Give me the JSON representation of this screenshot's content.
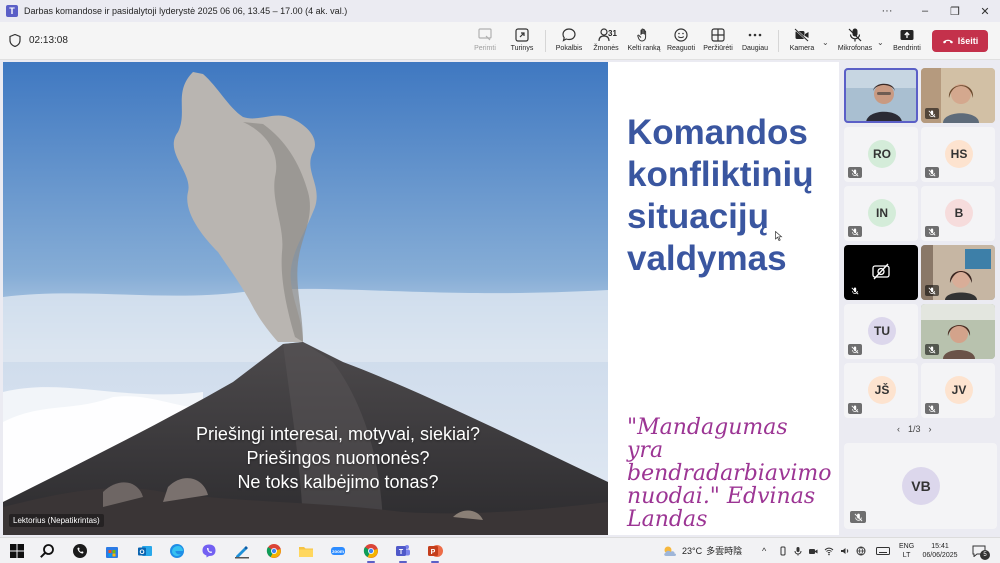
{
  "window": {
    "title": "Darbas komandose ir pasidalytoji lyderystė 2025 06 06, 13.45 – 17.00 (4 ak. val.)",
    "controls": {
      "more": "···",
      "minimize": "–",
      "maximize": "❐",
      "close": "✕"
    }
  },
  "meeting": {
    "timer": "02:13:08",
    "toolbar": {
      "take_control": "Perimti",
      "content": "Turinys",
      "chat": "Pokalbis",
      "people": "Žmonės",
      "people_count": "31",
      "raise_hand": "Kelti ranką",
      "react": "Reaguoti",
      "view": "Peržiūrėti",
      "more": "Daugiau",
      "camera": "Kamera",
      "mic": "Mikrofonas",
      "share": "Bendrinti",
      "leave": "Išeiti"
    }
  },
  "slide": {
    "overlay_lines": [
      "Priešingi interesai, motyvai, siekiai?",
      "Priešingos nuomonės?",
      "Ne toks kalbėjimo tonas?"
    ],
    "presenter_tag": "Lektorius (Nepatikrintas)",
    "title_lines": [
      "Komandos",
      "konfliktinių",
      "situacijų",
      "valdymas"
    ],
    "quote_lines": [
      "\"Mandagumas yra",
      "bendradarbiavimo",
      "nuodai.\"  Edvinas",
      "Landas"
    ]
  },
  "participants": {
    "tiles": [
      {
        "initials": "",
        "kind": "video-1",
        "avatar_color": ""
      },
      {
        "initials": "",
        "kind": "video-2",
        "avatar_color": ""
      },
      {
        "initials": "RO",
        "kind": "avatar",
        "avatar_color": "#d4ecd9"
      },
      {
        "initials": "HS",
        "kind": "avatar",
        "avatar_color": "#fde3cf"
      },
      {
        "initials": "IN",
        "kind": "avatar",
        "avatar_color": "#d4ecd9"
      },
      {
        "initials": "B",
        "kind": "avatar",
        "avatar_color": "#f6dcdc"
      },
      {
        "initials": "",
        "kind": "camera-off",
        "avatar_color": ""
      },
      {
        "initials": "",
        "kind": "video-3",
        "avatar_color": ""
      },
      {
        "initials": "TU",
        "kind": "avatar",
        "avatar_color": "#dcd7ec"
      },
      {
        "initials": "",
        "kind": "video-4",
        "avatar_color": ""
      },
      {
        "initials": "JŠ",
        "kind": "avatar",
        "avatar_color": "#fde3cf"
      },
      {
        "initials": "JV",
        "kind": "avatar",
        "avatar_color": "#fde3cf"
      }
    ],
    "pager": {
      "prev": "‹",
      "label": "1/3",
      "next": "›"
    },
    "featured": {
      "initials": "VB"
    }
  },
  "taskbar": {
    "weather": {
      "temp": "23°C",
      "condition": "多雲時陰"
    },
    "language": [
      "ENG",
      "LT"
    ],
    "clock": {
      "time": "15:41",
      "date": "06/06/2025"
    },
    "notifications": "5",
    "tray_caret": "^"
  },
  "colors": {
    "accent": "#5b5fc7",
    "leave": "#c4314b",
    "slide_title": "#3a56a0",
    "slide_quote": "#9c3594"
  }
}
